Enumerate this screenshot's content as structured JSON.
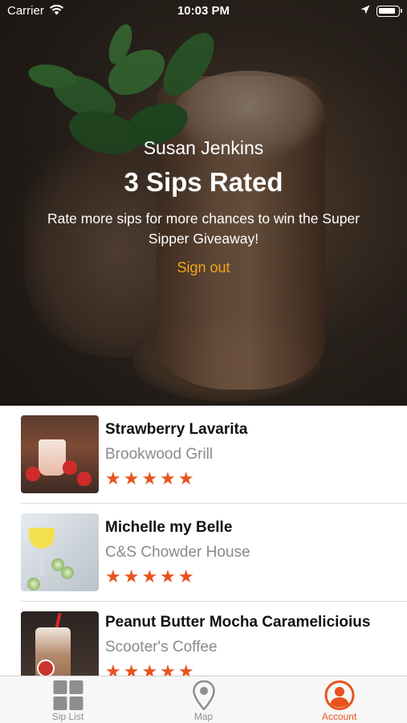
{
  "status_bar": {
    "carrier": "Carrier",
    "time": "10:03 PM"
  },
  "profile": {
    "name": "Susan Jenkins",
    "sips_rated": "3 Sips Rated",
    "message": "Rate more sips for more chances to win the Super Sipper Giveaway!",
    "sign_out": "Sign out"
  },
  "sips": [
    {
      "title": "Strawberry Lavarita",
      "place": "Brookwood Grill",
      "rating": 5,
      "stars": "★★★★★"
    },
    {
      "title": "Michelle my Belle",
      "place": "C&S Chowder House",
      "rating": 5,
      "stars": "★★★★★"
    },
    {
      "title": "Peanut Butter Mocha Caramelicioius",
      "place": "Scooter's Coffee",
      "rating": 5,
      "stars": "★★★★★"
    }
  ],
  "tabs": [
    {
      "label": "Sip List",
      "icon": "grid-icon"
    },
    {
      "label": "Map",
      "icon": "map-pin-icon"
    },
    {
      "label": "Account",
      "icon": "account-icon",
      "active": true
    }
  ],
  "colors": {
    "accent": "#e8531e",
    "sign_out": "#f4a41c"
  }
}
